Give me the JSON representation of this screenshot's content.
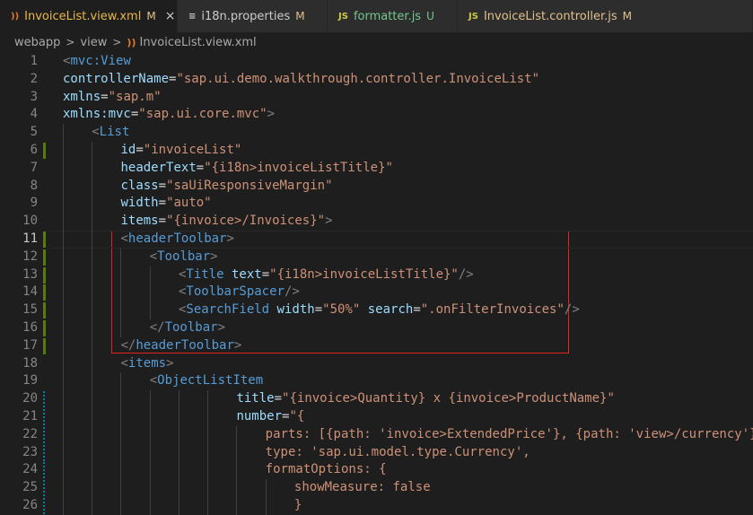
{
  "tabs": [
    {
      "icon": "rss-icon",
      "glyph": "))",
      "label": "InvoiceList.view.xml",
      "status": "M",
      "active": true,
      "close": "×"
    },
    {
      "icon": "lines-icon",
      "glyph": "≡",
      "label": "i18n.properties",
      "status": "M",
      "active": false
    },
    {
      "icon": "js-icon",
      "glyph": "JS",
      "label": "formatter.js",
      "status": "U",
      "active": false
    },
    {
      "icon": "js-icon",
      "glyph": "JS",
      "label": "InvoiceList.controller.js",
      "status": "M",
      "active": false
    }
  ],
  "breadcrumb": {
    "items": [
      "webapp",
      "view",
      "InvoiceList.view.xml"
    ],
    "separator": ">"
  },
  "colors": {
    "tag": "#569cd6",
    "attr": "#9cdcfe",
    "string": "#ce9178",
    "punct": "#808080",
    "text": "#d4d4d4",
    "gutter_modified": "#587c0c",
    "gutter_added": "#0c7d9d",
    "highlight": "#e02424"
  },
  "code_lines": [
    {
      "n": "1",
      "indent": 0,
      "tokens": [
        [
          "pun",
          "<"
        ],
        [
          "tag",
          "mvc:View"
        ]
      ]
    },
    {
      "n": "2",
      "indent": 0,
      "tokens": [
        [
          "attr",
          "controllerName"
        ],
        [
          "txt",
          "="
        ],
        [
          "str",
          "\"sap.ui.demo.walkthrough.controller.InvoiceList\""
        ]
      ]
    },
    {
      "n": "3",
      "indent": 0,
      "tokens": [
        [
          "attr",
          "xmlns"
        ],
        [
          "txt",
          "="
        ],
        [
          "str",
          "\"sap.m\""
        ]
      ]
    },
    {
      "n": "4",
      "indent": 0,
      "tokens": [
        [
          "attr",
          "xmlns:mvc"
        ],
        [
          "txt",
          "="
        ],
        [
          "str",
          "\"sap.ui.core.mvc\""
        ],
        [
          "pun",
          ">"
        ]
      ]
    },
    {
      "n": "5",
      "indent": 1,
      "tokens": [
        [
          "pun",
          "<"
        ],
        [
          "tag",
          "List"
        ]
      ]
    },
    {
      "n": "6",
      "indent": 2,
      "gutter": "modified",
      "tokens": [
        [
          "attr",
          "id"
        ],
        [
          "txt",
          "="
        ],
        [
          "str",
          "\"invoiceList\""
        ]
      ]
    },
    {
      "n": "7",
      "indent": 2,
      "tokens": [
        [
          "attr",
          "headerText"
        ],
        [
          "txt",
          "="
        ],
        [
          "str",
          "\"{i18n>invoiceListTitle}\""
        ]
      ]
    },
    {
      "n": "8",
      "indent": 2,
      "tokens": [
        [
          "attr",
          "class"
        ],
        [
          "txt",
          "="
        ],
        [
          "str",
          "\"saUiResponsiveMargin\""
        ]
      ]
    },
    {
      "n": "9",
      "indent": 2,
      "tokens": [
        [
          "attr",
          "width"
        ],
        [
          "txt",
          "="
        ],
        [
          "str",
          "\"auto\""
        ]
      ]
    },
    {
      "n": "10",
      "indent": 2,
      "tokens": [
        [
          "attr",
          "items"
        ],
        [
          "txt",
          "="
        ],
        [
          "str",
          "\"{invoice>/Invoices}\""
        ],
        [
          "pun",
          ">"
        ]
      ]
    },
    {
      "n": "11",
      "indent": 2,
      "gutter": "modified",
      "current": true,
      "tokens": [
        [
          "pun",
          "<"
        ],
        [
          "tag",
          "headerToolbar"
        ],
        [
          "pun",
          ">"
        ]
      ]
    },
    {
      "n": "12",
      "indent": 3,
      "gutter": "modified",
      "tokens": [
        [
          "pun",
          "<"
        ],
        [
          "tag",
          "Toolbar"
        ],
        [
          "pun",
          ">"
        ]
      ]
    },
    {
      "n": "13",
      "indent": 4,
      "gutter": "modified",
      "tokens": [
        [
          "pun",
          "<"
        ],
        [
          "tag",
          "Title"
        ],
        [
          "txt",
          " "
        ],
        [
          "attr",
          "text"
        ],
        [
          "txt",
          "="
        ],
        [
          "str",
          "\"{i18n>invoiceListTitle}\""
        ],
        [
          "pun",
          "/>"
        ]
      ]
    },
    {
      "n": "14",
      "indent": 4,
      "gutter": "modified",
      "tokens": [
        [
          "pun",
          "<"
        ],
        [
          "tag",
          "ToolbarSpacer"
        ],
        [
          "pun",
          "/>"
        ]
      ]
    },
    {
      "n": "15",
      "indent": 4,
      "gutter": "modified",
      "tokens": [
        [
          "pun",
          "<"
        ],
        [
          "tag",
          "SearchField"
        ],
        [
          "txt",
          " "
        ],
        [
          "attr",
          "width"
        ],
        [
          "txt",
          "="
        ],
        [
          "str",
          "\"50%\""
        ],
        [
          "txt",
          " "
        ],
        [
          "attr",
          "search"
        ],
        [
          "txt",
          "="
        ],
        [
          "str",
          "\".onFilterInvoices\""
        ],
        [
          "pun",
          "/>"
        ]
      ]
    },
    {
      "n": "16",
      "indent": 3,
      "gutter": "modified",
      "tokens": [
        [
          "pun",
          "</"
        ],
        [
          "tag",
          "Toolbar"
        ],
        [
          "pun",
          ">"
        ]
      ]
    },
    {
      "n": "17",
      "indent": 2,
      "gutter": "modified",
      "tokens": [
        [
          "pun",
          "</"
        ],
        [
          "tag",
          "headerToolbar"
        ],
        [
          "pun",
          ">"
        ]
      ]
    },
    {
      "n": "18",
      "indent": 2,
      "tokens": [
        [
          "pun",
          "<"
        ],
        [
          "tag",
          "items"
        ],
        [
          "pun",
          ">"
        ]
      ]
    },
    {
      "n": "19",
      "indent": 3,
      "tokens": [
        [
          "pun",
          "<"
        ],
        [
          "tag",
          "ObjectListItem"
        ]
      ]
    },
    {
      "n": "20",
      "indent": 6,
      "gutter": "added",
      "tokens": [
        [
          "attr",
          "title"
        ],
        [
          "txt",
          "="
        ],
        [
          "str",
          "\"{invoice>Quantity} x {invoice>ProductName}\""
        ]
      ]
    },
    {
      "n": "21",
      "indent": 6,
      "gutter": "added",
      "tokens": [
        [
          "attr",
          "number"
        ],
        [
          "txt",
          "="
        ],
        [
          "str",
          "\"{"
        ]
      ]
    },
    {
      "n": "22",
      "indent": 7,
      "gutter": "added",
      "tokens": [
        [
          "str",
          "parts: [{path: 'invoice>ExtendedPrice'}, {path: 'view>/currency'}],"
        ]
      ]
    },
    {
      "n": "23",
      "indent": 7,
      "gutter": "added",
      "tokens": [
        [
          "str",
          "type: 'sap.ui.model.type.Currency',"
        ]
      ]
    },
    {
      "n": "24",
      "indent": 7,
      "gutter": "added",
      "tokens": [
        [
          "str",
          "formatOptions: {"
        ]
      ]
    },
    {
      "n": "25",
      "indent": 8,
      "gutter": "added",
      "tokens": [
        [
          "str",
          "showMeasure: false"
        ]
      ]
    },
    {
      "n": "26",
      "indent": 8,
      "gutter": "added",
      "tokens": [
        [
          "str",
          "}"
        ]
      ]
    }
  ]
}
